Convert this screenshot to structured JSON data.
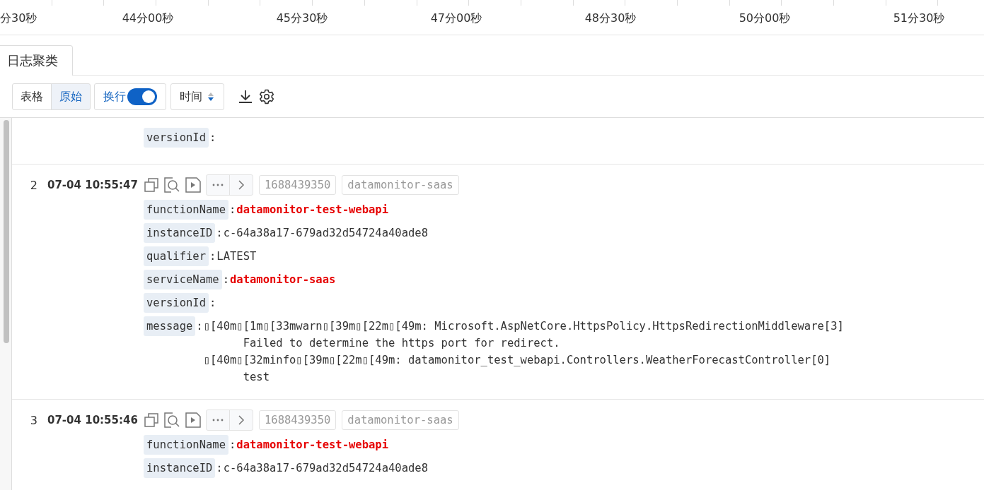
{
  "time_axis": {
    "labels": [
      "分30秒",
      "44分00秒",
      "45分30秒",
      "47分00秒",
      "48分30秒",
      "50分00秒",
      "51分30秒"
    ]
  },
  "tabs": [
    {
      "label": "日志聚类",
      "selected": true
    }
  ],
  "toolbar": {
    "view_modes": [
      {
        "label": "表格",
        "selected": false
      },
      {
        "label": "原始",
        "selected": true
      }
    ],
    "wrap": {
      "label": "换行",
      "on": true
    },
    "sort": {
      "label": "时间"
    }
  },
  "logs": [
    {
      "fields": [
        {
          "key": "versionId",
          "sep": ":"
        }
      ]
    },
    {
      "index": "2",
      "time": "07-04 10:55:47",
      "tags": [
        "1688439350",
        "datamonitor-saas"
      ],
      "fields": [
        {
          "key": "functionName",
          "sep": ":",
          "value": "datamonitor-test-webapi",
          "highlight": true
        },
        {
          "key": "instanceID",
          "sep": ":",
          "value": "c-64a38a17-679ad32d54724a40ade8",
          "highlight": false
        },
        {
          "key": "qualifier",
          "sep": ":",
          "value": "LATEST",
          "highlight": false
        },
        {
          "key": "serviceName",
          "sep": ":",
          "value": "datamonitor-saas",
          "highlight": true
        },
        {
          "key": "versionId",
          "sep": ":"
        },
        {
          "key": "message",
          "sep": ":",
          "value": "▯[40m▯[1m▯[33mwarn▯[39m▯[22m▯[49m: Microsoft.AspNetCore.HttpsPolicy.HttpsRedirectionMiddleware[3]\n      Failed to determine the https port for redirect.\n▯[40m▯[32minfo▯[39m▯[22m▯[49m: datamonitor_test_webapi.Controllers.WeatherForecastController[0]\n      test",
          "highlight": false
        }
      ]
    },
    {
      "index": "3",
      "time": "07-04 10:55:46",
      "tags": [
        "1688439350",
        "datamonitor-saas"
      ],
      "fields": [
        {
          "key": "functionName",
          "sep": ":",
          "value": "datamonitor-test-webapi",
          "highlight": true
        },
        {
          "key": "instanceID",
          "sep": ":",
          "value": "c-64a38a17-679ad32d54724a40ade8",
          "highlight": false
        }
      ]
    }
  ]
}
